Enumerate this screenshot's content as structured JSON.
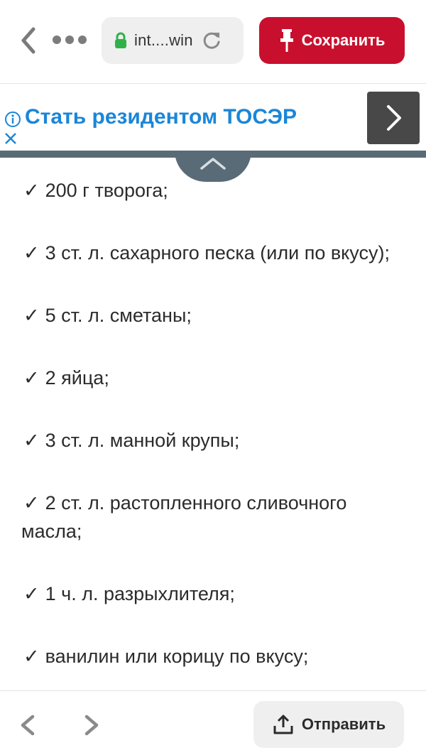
{
  "topbar": {
    "url": "int....win",
    "save_label": "Сохранить",
    "colors": {
      "save_bg": "#c8102e",
      "url_bg": "#efefef"
    }
  },
  "ad": {
    "title": "Стать резидентом ТОСЭР",
    "title_color": "#1a86d8",
    "info_icon": "info-icon",
    "close_icon": "close-icon",
    "arrow_icon": "chevron-right-icon"
  },
  "ingredients": [
    {
      "check": "✓",
      "text": "200 г творога;"
    },
    {
      "check": "✓",
      "text": "3 ст. л. сахарного песка (или по вкусу);"
    },
    {
      "check": "✓",
      "text": "5 ст. л. сметаны;"
    },
    {
      "check": "✓",
      "text": "2 яйца;"
    },
    {
      "check": "✓",
      "text": "3 ст. л. манной крупы;"
    },
    {
      "check": "✓",
      "text": "2 ст. л. растопленного сливочного масла;"
    },
    {
      "check": "✓",
      "text": "1 ч. л. разрыхлителя;"
    },
    {
      "check": "✓",
      "text": "ванилин или корицу по вкусу;"
    }
  ],
  "bottombar": {
    "send_label": "Отправить"
  }
}
